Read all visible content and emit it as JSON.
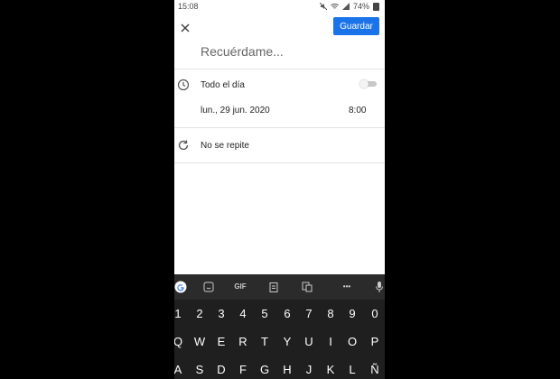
{
  "status": {
    "time": "15:08",
    "battery": "74%"
  },
  "header": {
    "save_label": "Guardar"
  },
  "title_input": {
    "placeholder": "Recuérdame..."
  },
  "allday": {
    "label": "Todo el día",
    "enabled": false
  },
  "datetime": {
    "date": "lun., 29 jun. 2020",
    "time": "8:00"
  },
  "repeat": {
    "label": "No se repite"
  },
  "keyboard": {
    "toolbar": {
      "gif_label": "GIF",
      "more_label": "•••"
    },
    "numbers": [
      "1",
      "2",
      "3",
      "4",
      "5",
      "6",
      "7",
      "8",
      "9",
      "0"
    ],
    "row1": [
      "Q",
      "W",
      "E",
      "R",
      "T",
      "Y",
      "U",
      "I",
      "O",
      "P"
    ],
    "row2": [
      "A",
      "S",
      "D",
      "F",
      "G",
      "H",
      "J",
      "K",
      "L",
      "Ñ"
    ]
  }
}
